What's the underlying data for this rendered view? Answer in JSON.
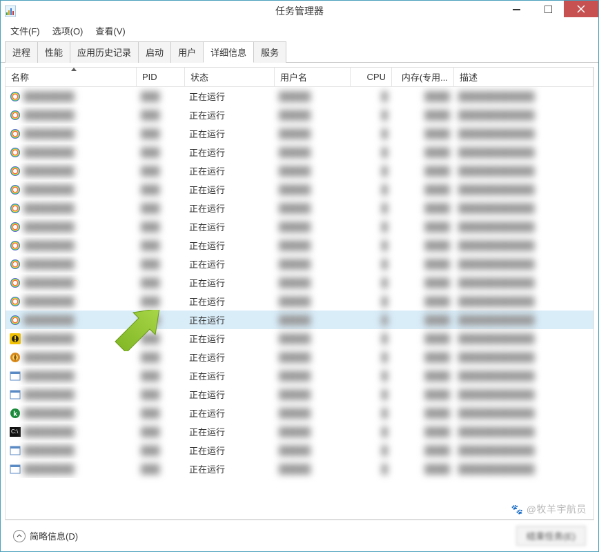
{
  "window": {
    "title": "任务管理器"
  },
  "menubar": {
    "file": "文件(F)",
    "options": "选项(O)",
    "view": "查看(V)"
  },
  "tabs": [
    {
      "label": "进程",
      "active": false
    },
    {
      "label": "性能",
      "active": false
    },
    {
      "label": "应用历史记录",
      "active": false
    },
    {
      "label": "启动",
      "active": false
    },
    {
      "label": "用户",
      "active": false
    },
    {
      "label": "详细信息",
      "active": true
    },
    {
      "label": "服务",
      "active": false
    }
  ],
  "columns": {
    "name": "名称",
    "pid": "PID",
    "status": "状态",
    "user": "用户名",
    "cpu": "CPU",
    "mem": "内存(专用...",
    "desc": "描述"
  },
  "status_value": "正在运行",
  "rows": [
    {
      "icon": "rainbow",
      "selected": false
    },
    {
      "icon": "rainbow",
      "selected": false
    },
    {
      "icon": "rainbow",
      "selected": false
    },
    {
      "icon": "rainbow",
      "selected": false
    },
    {
      "icon": "rainbow",
      "selected": false
    },
    {
      "icon": "rainbow",
      "selected": false
    },
    {
      "icon": "rainbow",
      "selected": false
    },
    {
      "icon": "rainbow",
      "selected": false
    },
    {
      "icon": "rainbow",
      "selected": false
    },
    {
      "icon": "rainbow",
      "selected": false
    },
    {
      "icon": "rainbow",
      "selected": false
    },
    {
      "icon": "rainbow",
      "selected": false
    },
    {
      "icon": "rainbow",
      "selected": true
    },
    {
      "icon": "warn",
      "selected": false
    },
    {
      "icon": "amber",
      "selected": false
    },
    {
      "icon": "wnd",
      "selected": false
    },
    {
      "icon": "wnd",
      "selected": false
    },
    {
      "icon": "kav",
      "selected": false
    },
    {
      "icon": "cmd",
      "selected": false
    },
    {
      "icon": "wnd",
      "selected": false
    },
    {
      "icon": "wnd",
      "selected": false
    }
  ],
  "footer": {
    "fewer": "简略信息(D)",
    "end_task": "结束任务(E)"
  },
  "watermark": "@牧羊宇航员",
  "icon_names": {
    "rainbow": "rainbow-circle-icon",
    "warn": "warning-icon",
    "amber": "amber-circle-icon",
    "wnd": "window-icon",
    "kav": "kaspersky-icon",
    "cmd": "command-prompt-icon"
  }
}
